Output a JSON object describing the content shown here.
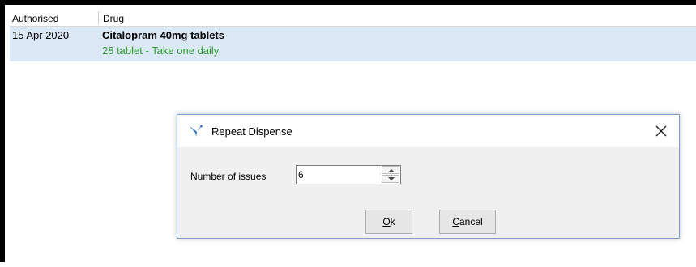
{
  "grid": {
    "columns": {
      "authorised": "Authorised",
      "drug": "Drug"
    },
    "rows": [
      {
        "authorised": "15 Apr 2020",
        "drug": "Citalopram 40mg tablets",
        "instructions": "28 tablet - Take one daily"
      }
    ]
  },
  "dialog": {
    "title": "Repeat Dispense",
    "issues_label": "Number of issues",
    "issues_value": "6",
    "ok_mnemonic": "O",
    "ok_rest": "k",
    "cancel_mnemonic": "C",
    "cancel_rest": "ancel",
    "app_icon": "funnel-logo-icon",
    "close_icon": "close-icon"
  },
  "colors": {
    "row_selected": "#dbe8f6",
    "instructions_text": "#2e9a2e",
    "app_icon": "#2a72c9"
  }
}
